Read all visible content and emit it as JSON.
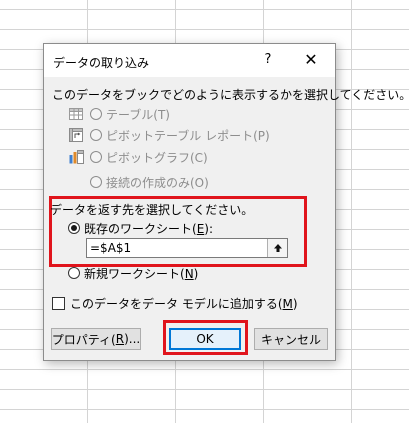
{
  "dialog": {
    "title": "データの取り込み",
    "help_label": "?",
    "close_label": "✕",
    "prompt": "このデータをブックでどのように表示するかを選択してください。",
    "view_options": [
      {
        "label": "テーブル(T)",
        "icon": "table-icon"
      },
      {
        "label": "ピボットテーブル レポート(P)",
        "icon": "pivot-table-icon"
      },
      {
        "label": "ピボットグラフ(C)",
        "icon": "pivot-chart-icon"
      },
      {
        "label": "接続の作成のみ(O)",
        "icon": "connection-icon"
      }
    ],
    "destination": {
      "label": "データを返す先を選択してください。",
      "existing_prefix": "既存のワークシート(",
      "existing_key": "E",
      "existing_suffix": "):",
      "reference": "=$A$1",
      "newsheet_prefix": "新規ワークシート(",
      "newsheet_key": "N",
      "newsheet_suffix": ")"
    },
    "add_model_prefix": "このデータをデータ モデルに追加する(",
    "add_model_key": "M",
    "add_model_suffix": ")",
    "buttons": {
      "properties_prefix": "プロパティ(",
      "properties_key": "R",
      "properties_suffix": ")...",
      "ok": "OK",
      "cancel": "キャンセル"
    }
  },
  "colors": {
    "highlight": "#e0141c",
    "accent": "#0078d7",
    "dialog_bg": "#f0f0f0",
    "disabled_text": "#8d8d8d"
  }
}
